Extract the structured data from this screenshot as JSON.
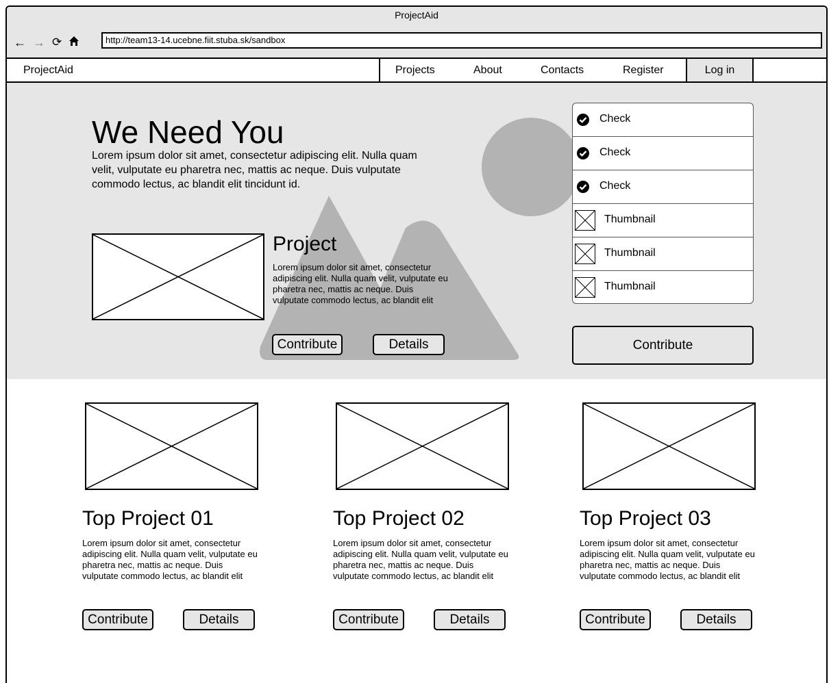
{
  "window": {
    "title": "ProjectAid"
  },
  "toolbar": {
    "back_icon": "back-arrow-icon",
    "forward_icon": "forward-arrow-icon",
    "reload_icon": "reload-icon",
    "home_icon": "home-icon",
    "url": "http://team13-14.ucebne.fiit.stuba.sk/sandbox"
  },
  "nav": {
    "brand": "ProjectAid",
    "items": [
      "Projects",
      "About",
      "Contacts",
      "Register"
    ],
    "login": "Log in"
  },
  "hero": {
    "title": "We Need You",
    "text": "Lorem ipsum dolor sit amet, consectetur adipiscing elit. Nulla quam velit, vulputate eu pharetra nec, mattis ac neque. Duis vulputate commodo lectus, ac blandit elit tincidunt id.",
    "featured": {
      "title": "Project",
      "text": "Lorem ipsum dolor sit amet, consectetur adipiscing elit. Nulla quam velit, vulputate eu pharetra nec, mattis ac neque. Duis vulputate commodo lectus, ac blandit elit",
      "contribute": "Contribute",
      "details": "Details"
    },
    "list": [
      {
        "type": "check",
        "label": "Check"
      },
      {
        "type": "check",
        "label": "Check"
      },
      {
        "type": "check",
        "label": "Check"
      },
      {
        "type": "thumbnail",
        "label": "Thumbnail"
      },
      {
        "type": "thumbnail",
        "label": "Thumbnail"
      },
      {
        "type": "thumbnail",
        "label": "Thumbnail"
      }
    ],
    "contribute_big": "Contribute"
  },
  "projects": [
    {
      "title": "Top Project 01",
      "text": "Lorem ipsum dolor sit amet, consectetur adipiscing elit. Nulla quam velit, vulputate eu pharetra nec, mattis ac neque. Duis vulputate commodo lectus, ac blandit elit",
      "contribute": "Contribute",
      "details": "Details"
    },
    {
      "title": "Top Project 02",
      "text": "Lorem ipsum dolor sit amet, consectetur adipiscing elit. Nulla quam velit, vulputate eu pharetra nec, mattis ac neque. Duis vulputate commodo lectus, ac blandit elit",
      "contribute": "Contribute",
      "details": "Details"
    },
    {
      "title": "Top Project 03",
      "text": "Lorem ipsum dolor sit amet, consectetur adipiscing elit. Nulla quam velit, vulputate eu pharetra nec, mattis ac neque. Duis vulputate commodo lectus, ac blandit elit",
      "contribute": "Contribute",
      "details": "Details"
    }
  ],
  "colors": {
    "panel_gray": "#e6e6e6",
    "art_gray": "#b3b3b3",
    "border": "#000000"
  }
}
